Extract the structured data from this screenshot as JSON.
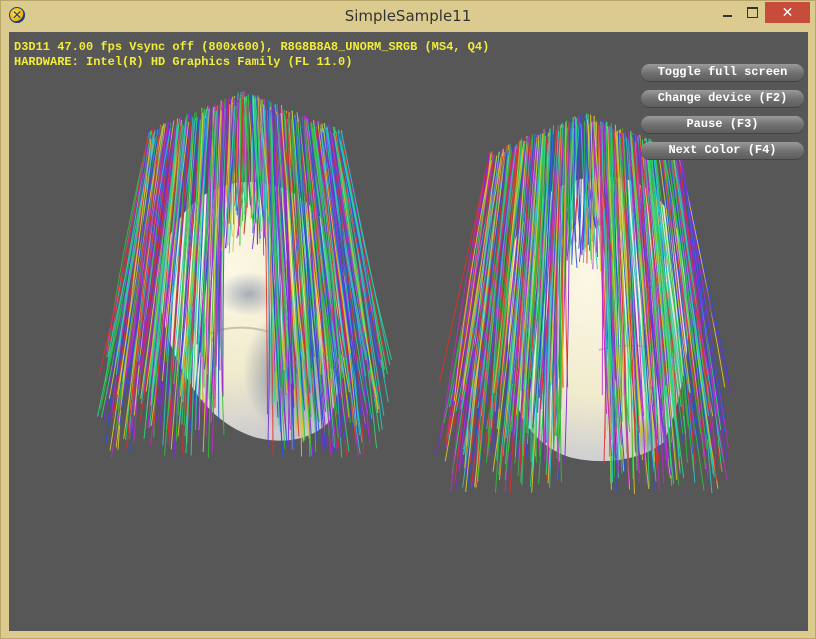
{
  "window": {
    "title": "SimpleSample11",
    "close_glyph": "✕"
  },
  "hud": {
    "line1": "D3D11 47.00 fps Vsync off (800x600), R8G8B8A8_UNORM_SRGB (MS4, Q4)",
    "line2": "HARDWARE: Intel(R) HD Graphics Family (FL 11.0)",
    "text_color": "#f2ec3a"
  },
  "buttons": {
    "toggle_full_screen": "Toggle full screen",
    "change_device": "Change device (F2)",
    "pause": "Pause (F3)",
    "next_color": "Next Color (F4)"
  },
  "scene": {
    "background": "#575757",
    "hair_colors": [
      "#e0302a",
      "#2fbf3a",
      "#2a4fd8",
      "#c02ac8",
      "#27c6c8",
      "#d8c82a",
      "#7a2ad8",
      "#2ad87a"
    ],
    "skin_color": "#f4efd6",
    "shadow_color": "#5f6f95"
  }
}
